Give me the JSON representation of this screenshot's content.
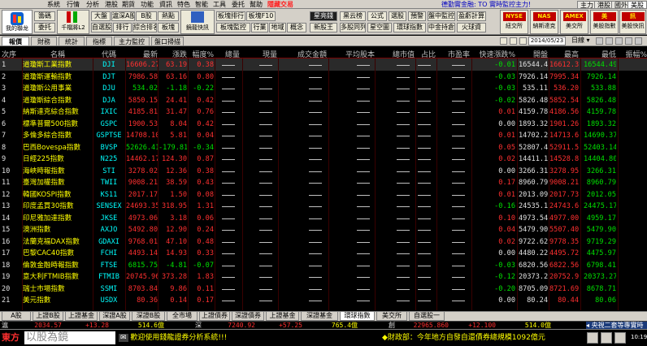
{
  "menubar": {
    "items": [
      "系統",
      "行情",
      "分析",
      "港股",
      "期貨",
      "功能",
      "資訊",
      "特色",
      "智能",
      "工具",
      "委托",
      "幫助",
      "隱藏交易"
    ],
    "ad_text": "德勤實金融: TO 實時監控主力!",
    "market_tabs": [
      "主力",
      "港股",
      "國外",
      "美股"
    ],
    "selected_market_tab": "美股"
  },
  "toolbar": {
    "logo_label": "我的聯龙",
    "small_buttons_col1": [
      "籌碼",
      "委托"
    ],
    "big_button_1": "千檔將L2",
    "combo_row1": [
      "大盤",
      "滬深A股",
      "B股",
      "熱點"
    ],
    "combo_row2": [
      "自選股",
      "排行",
      "綜合排名",
      "板塊"
    ],
    "big_button_2": "鏡龍快訊",
    "row_buttons_a": [
      "板塊排行",
      "板塊F10"
    ],
    "row_buttons_b": [
      "板塊監控",
      "行業",
      "地域",
      "概念"
    ],
    "mid_buttons_a": [
      "星亮錢",
      "黑云榜",
      "公式",
      "選股",
      "預警",
      "盤中監控",
      "盈虧計算"
    ],
    "mid_buttons_b": [
      "新股王",
      "多股同列",
      "星空圖",
      "環球指數",
      "中金持倉",
      "火球資"
    ],
    "right_buttons": [
      {
        "badge": "NYSE",
        "label": "紐交所"
      },
      {
        "badge": "NAS",
        "label": "納斯達克"
      },
      {
        "badge": "AMEX",
        "label": "美交所"
      },
      {
        "badge": "美",
        "label": "美股指數"
      },
      {
        "badge": "訊",
        "label": "美股快訊"
      }
    ]
  },
  "toprow": {
    "tabs": [
      "報價",
      "財務",
      "統計",
      "指標",
      "主力監控",
      "盤口掃描"
    ],
    "selected_tab": "報價",
    "date": "2014/05/23",
    "cycle": "日線"
  },
  "grid": {
    "headers": [
      "次序",
      "名稱",
      "代碼",
      "最新",
      "漲跌",
      "幅度%",
      "總量",
      "現量",
      "成交金額",
      "平均股本",
      "總市值",
      "占比",
      "市盈率",
      "快速漲跌%",
      "開盤",
      "最高",
      "最低",
      "振幅%"
    ],
    "rows": [
      {
        "n": "1",
        "name": "道瓊斯工業指數",
        "code": "DJI",
        "last": "16606.27",
        "chg": "63.19",
        "pct": "0.38",
        "fast": "-0.01",
        "open": "16544.49",
        "high": "16612.30",
        "low": "16544.49",
        "dir": "up"
      },
      {
        "n": "2",
        "name": "道瓊斯運輸指數",
        "code": "DJT",
        "last": "7986.58",
        "chg": "63.16",
        "pct": "0.80",
        "fast": "-0.03",
        "open": "7926.14",
        "high": "7995.34",
        "low": "7926.14",
        "dir": "up"
      },
      {
        "n": "3",
        "name": "道瓊斯公用事業",
        "code": "DJU",
        "last": "534.02",
        "chg": "-1.18",
        "pct": "-0.22",
        "fast": "-0.03",
        "open": "535.11",
        "high": "536.20",
        "low": "533.88",
        "dir": "down"
      },
      {
        "n": "4",
        "name": "道瓊斯綜合指數",
        "code": "DJA",
        "last": "5850.15",
        "chg": "24.41",
        "pct": "0.42",
        "fast": "-0.02",
        "open": "5826.48",
        "high": "5852.54",
        "low": "5826.48",
        "dir": "up"
      },
      {
        "n": "5",
        "name": "納斯達克綜合指數",
        "code": "IXIC",
        "last": "4185.81",
        "chg": "31.47",
        "pct": "0.76",
        "fast": "0.01",
        "open": "4159.78",
        "high": "4186.56",
        "low": "4159.78",
        "dir": "up"
      },
      {
        "n": "6",
        "name": "標準普爾500指數",
        "code": "GSPC",
        "last": "1900.53",
        "chg": "8.04",
        "pct": "0.42",
        "fast": "0.00",
        "open": "1893.32",
        "high": "1901.26",
        "low": "1893.32",
        "dir": "up"
      },
      {
        "n": "7",
        "name": "多倫多綜合指數",
        "code": "GSPTSE",
        "last": "14708.10",
        "chg": "5.81",
        "pct": "0.04",
        "fast": "0.01",
        "open": "14702.29",
        "high": "14713.69",
        "low": "14690.37",
        "dir": "up"
      },
      {
        "n": "8",
        "name": "巴西Bovespa指數",
        "code": "BVSP",
        "last": "52626.41",
        "chg": "-179.81",
        "pct": "-0.34",
        "fast": "0.05",
        "open": "52807.48",
        "high": "52911.51",
        "low": "52403.14",
        "dir": "down"
      },
      {
        "n": "9",
        "name": "日經225指數",
        "code": "N225",
        "last": "14462.17",
        "chg": "124.30",
        "pct": "0.87",
        "fast": "0.02",
        "open": "14411.10",
        "high": "14528.84",
        "low": "14404.80",
        "dir": "up"
      },
      {
        "n": "10",
        "name": "海峽時報指數",
        "code": "STI",
        "last": "3278.02",
        "chg": "12.36",
        "pct": "0.38",
        "fast": "0.00",
        "open": "3266.31",
        "high": "3278.95",
        "low": "3266.31",
        "dir": "up"
      },
      {
        "n": "11",
        "name": "臺灣加權指數",
        "code": "TWII",
        "last": "9008.21",
        "chg": "38.59",
        "pct": "0.43",
        "fast": "0.17",
        "open": "8960.79",
        "high": "9008.21",
        "low": "8960.79",
        "dir": "up"
      },
      {
        "n": "12",
        "name": "韓國KOSPI指數",
        "code": "KS11",
        "last": "2017.17",
        "chg": "1.50",
        "pct": "0.08",
        "fast": "0.01",
        "open": "2013.09",
        "high": "2017.73",
        "low": "2012.05",
        "dir": "up"
      },
      {
        "n": "13",
        "name": "印度孟買30指數",
        "code": "SENSEX",
        "last": "24693.35",
        "chg": "318.95",
        "pct": "1.31",
        "fast": "-0.16",
        "open": "24535.14",
        "high": "24743.64",
        "low": "24475.17",
        "dir": "up"
      },
      {
        "n": "14",
        "name": "印尼雅加達指數",
        "code": "JKSE",
        "last": "4973.06",
        "chg": "3.18",
        "pct": "0.06",
        "fast": "0.10",
        "open": "4973.54",
        "high": "4977.00",
        "low": "4959.17",
        "dir": "up"
      },
      {
        "n": "15",
        "name": "澳洲指數",
        "code": "AXJO",
        "last": "5492.80",
        "chg": "12.90",
        "pct": "0.24",
        "fast": "0.04",
        "open": "5479.90",
        "high": "5507.40",
        "low": "5479.90",
        "dir": "up"
      },
      {
        "n": "16",
        "name": "法蘭克福DAX指數",
        "code": "GDAXI",
        "last": "9768.01",
        "chg": "47.10",
        "pct": "0.48",
        "fast": "0.02",
        "open": "9722.62",
        "high": "9778.35",
        "low": "9719.29",
        "dir": "up"
      },
      {
        "n": "17",
        "name": "巴黎CAC40指數",
        "code": "FCHI",
        "last": "4493.14",
        "chg": "14.93",
        "pct": "0.33",
        "fast": "0.00",
        "open": "4480.22",
        "high": "4495.72",
        "low": "4475.97",
        "dir": "up"
      },
      {
        "n": "18",
        "name": "倫敦金融時報指數",
        "code": "FTSE",
        "last": "6815.75",
        "chg": "-4.81",
        "pct": "-0.07",
        "fast": "-0.03",
        "open": "6820.56",
        "high": "6822.56",
        "low": "6798.41",
        "dir": "down"
      },
      {
        "n": "19",
        "name": "意大利FTMIB指數",
        "code": "FTMIB",
        "last": "20745.96",
        "chg": "373.28",
        "pct": "1.83",
        "fast": "-0.12",
        "open": "20373.27",
        "high": "20752.90",
        "low": "20373.27",
        "dir": "up"
      },
      {
        "n": "20",
        "name": "瑞士市場指數",
        "code": "SSMI",
        "last": "8703.84",
        "chg": "9.86",
        "pct": "0.11",
        "fast": "-0.20",
        "open": "8705.09",
        "high": "8721.69",
        "low": "8678.71",
        "dir": "up"
      },
      {
        "n": "21",
        "name": "美元指數",
        "code": "USDX",
        "last": "80.36",
        "chg": "0.14",
        "pct": "0.17",
        "fast": "0.00",
        "open": "80.24",
        "high": "80.44",
        "low": "80.06",
        "dir": "up"
      }
    ],
    "empty_mark": "—",
    "selected_row": 0
  },
  "bottom_tabs": [
    "A股",
    "上證B股",
    "上證基金",
    "深證A股",
    "深證B股",
    "全市場",
    "上證債券",
    "深證債券",
    "上證基金",
    "深證基金",
    "環球指數",
    "美交所",
    "自選股一"
  ],
  "selected_bottom_tab": "環球指數",
  "index_strip": {
    "items": [
      {
        "label": "滬",
        "value": "2034.57",
        "chg": "+13.28",
        "vol": "514.6億"
      },
      {
        "label": "深",
        "value": "7240.92",
        "chg": "+57.25",
        "vol": "765.4億"
      },
      {
        "label": "創",
        "value": "22965.860",
        "chg": "+12.100",
        "vol": "514.0億"
      }
    ],
    "scroll_text": "央視二套等專實時"
  },
  "status": {
    "logo_text": "東方",
    "brand_text": "以股為鏡",
    "welcome": "歡迎使用錢龍證券分析系統!!!",
    "news": "◆財政部：今年地方自發自還債券總規模1092億元",
    "clock": "10:19"
  }
}
